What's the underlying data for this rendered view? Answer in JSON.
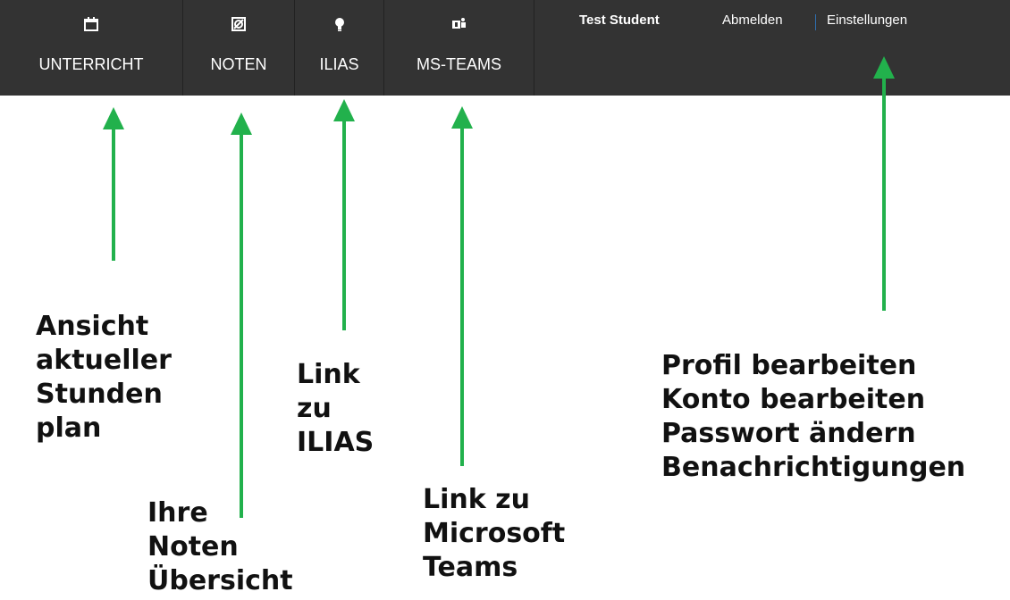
{
  "nav": {
    "items": [
      {
        "label": "UNTERRICHT",
        "icon": "calendar-icon"
      },
      {
        "label": "NOTEN",
        "icon": "grades-icon"
      },
      {
        "label": "ILIAS",
        "icon": "lightbulb-icon"
      },
      {
        "label": "MS-TEAMS",
        "icon": "teams-icon"
      }
    ]
  },
  "user": {
    "name": "Test Student",
    "logout": "Abmelden",
    "settings": "Einstellungen"
  },
  "annotations": {
    "unterricht": [
      "Ansicht",
      "aktueller",
      "Stunden",
      "plan"
    ],
    "noten": [
      "Ihre",
      "Noten",
      "Übersicht"
    ],
    "ilias": [
      "Link",
      "zu",
      "ILIAS"
    ],
    "teams": [
      "Link zu",
      "Microsoft",
      "Teams"
    ],
    "settings": [
      "Profil bearbeiten",
      "Konto bearbeiten",
      "Passwort ändern",
      "Benachrichtigungen"
    ]
  },
  "colors": {
    "navbar_bg": "#333333",
    "arrow": "#22b14c",
    "separator": "#2f6fb0"
  }
}
